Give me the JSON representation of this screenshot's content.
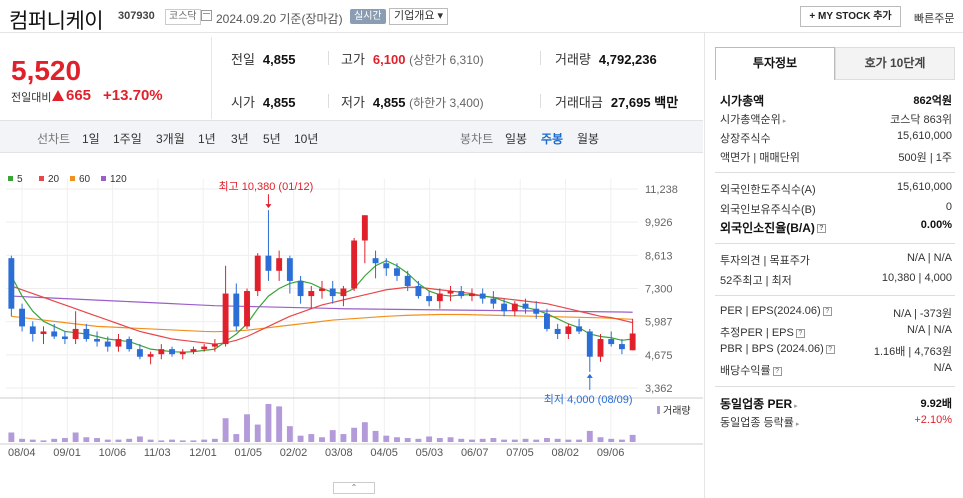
{
  "header": {
    "name": "컴퍼니케이",
    "code": "307930",
    "market": "코스닥",
    "base_time": "2024.09.20 기준(장마감)",
    "realtime": "실시간",
    "corp_info": "기업개요 ▾",
    "mystock": "+ MY STOCK 추가",
    "quick_order": "빠른주문"
  },
  "price": {
    "current": "5,520",
    "prev_label": "전일대비",
    "change": "665",
    "change_pct": "+13.70%"
  },
  "stats": {
    "prev_close_label": "전일",
    "prev_close": "4,855",
    "high_label": "고가",
    "high": "6,100",
    "upper_limit": "(상한가 6,310)",
    "volume_label": "거래량",
    "volume": "4,792,236",
    "open_label": "시가",
    "open": "4,855",
    "low_label": "저가",
    "low": "4,855",
    "lower_limit": "(하한가 3,400)",
    "amount_label": "거래대금",
    "amount": "27,695",
    "amount_unit": "백만"
  },
  "ranges": {
    "line_label": "선차트",
    "line": [
      "1일",
      "1주일",
      "3개월",
      "1년",
      "3년",
      "5년",
      "10년"
    ],
    "candle_label": "봉차트",
    "candle": [
      "일봉",
      "주봉",
      "월봉"
    ],
    "candle_selected": "주봉"
  },
  "chart_data": {
    "type": "candlestick",
    "legend": [
      "5",
      "20",
      "60",
      "120"
    ],
    "legend_colors": [
      "#3aa43a",
      "#e8474a",
      "#f0911f",
      "#9b5fc9"
    ],
    "y_ticks": [
      "11,238",
      "9,926",
      "8,613",
      "7,300",
      "5,987",
      "4,675",
      "3,362"
    ],
    "ylim": [
      3362,
      11238
    ],
    "x_labels": [
      "08/04",
      "09/01",
      "10/06",
      "11/03",
      "12/01",
      "01/05",
      "02/02",
      "03/08",
      "04/05",
      "05/03",
      "06/07",
      "07/05",
      "08/02",
      "09/06"
    ],
    "volume_label": "거래량",
    "annot_high": "최고 10,380 (01/12)",
    "annot_low": "최저 4,000 (08/09)",
    "candles": [
      [
        8500,
        8600,
        6200,
        6500
      ],
      [
        6500,
        6700,
        5600,
        5800
      ],
      [
        5800,
        6000,
        5200,
        5500
      ],
      [
        5500,
        5800,
        5100,
        5600
      ],
      [
        5600,
        5900,
        5300,
        5400
      ],
      [
        5400,
        5600,
        5100,
        5300
      ],
      [
        5300,
        6400,
        5100,
        5700
      ],
      [
        5700,
        5900,
        5200,
        5300
      ],
      [
        5300,
        5600,
        5000,
        5200
      ],
      [
        5200,
        5400,
        4800,
        5000
      ],
      [
        5000,
        5500,
        4800,
        5300
      ],
      [
        5300,
        5400,
        4800,
        4900
      ],
      [
        4900,
        5100,
        4500,
        4600
      ],
      [
        4600,
        4800,
        4300,
        4700
      ],
      [
        4700,
        5100,
        4500,
        4900
      ],
      [
        4900,
        5000,
        4600,
        4700
      ],
      [
        4700,
        4900,
        4500,
        4800
      ],
      [
        4800,
        5000,
        4700,
        4900
      ],
      [
        4900,
        5100,
        4800,
        5000
      ],
      [
        5000,
        5300,
        4800,
        5100
      ],
      [
        5100,
        8200,
        5000,
        7100
      ],
      [
        7100,
        7500,
        5600,
        5800
      ],
      [
        5800,
        7300,
        5700,
        7200
      ],
      [
        7200,
        8700,
        7000,
        8600
      ],
      [
        8600,
        10400,
        7600,
        8000
      ],
      [
        8000,
        8800,
        7600,
        8500
      ],
      [
        8500,
        8600,
        7100,
        7600
      ],
      [
        7600,
        7800,
        6700,
        7000
      ],
      [
        7000,
        7400,
        6500,
        7200
      ],
      [
        7200,
        7600,
        6900,
        7300
      ],
      [
        7300,
        7600,
        6700,
        7000
      ],
      [
        7000,
        7400,
        6600,
        7300
      ],
      [
        7300,
        9300,
        7200,
        9200
      ],
      [
        9200,
        10200,
        8300,
        10200
      ],
      [
        8500,
        8800,
        7700,
        8300
      ],
      [
        8300,
        8500,
        7800,
        8100
      ],
      [
        8100,
        8300,
        7600,
        7800
      ],
      [
        7800,
        8000,
        7200,
        7400
      ],
      [
        7400,
        7600,
        6900,
        7000
      ],
      [
        7000,
        7200,
        6600,
        6800
      ],
      [
        6800,
        7300,
        6500,
        7100
      ],
      [
        7100,
        7400,
        6800,
        7200
      ],
      [
        7200,
        7400,
        6900,
        7000
      ],
      [
        7000,
        7300,
        6800,
        7100
      ],
      [
        7100,
        7300,
        6700,
        6900
      ],
      [
        6900,
        7200,
        6500,
        6700
      ],
      [
        6700,
        6900,
        6200,
        6400
      ],
      [
        6400,
        6800,
        6200,
        6700
      ],
      [
        6700,
        6900,
        6300,
        6500
      ],
      [
        6500,
        6800,
        6100,
        6300
      ],
      [
        6300,
        6500,
        5600,
        5700
      ],
      [
        5700,
        5900,
        5300,
        5500
      ],
      [
        5500,
        5900,
        5300,
        5800
      ],
      [
        5800,
        6100,
        5500,
        5600
      ],
      [
        5600,
        5700,
        4000,
        4600
      ],
      [
        4600,
        5500,
        4400,
        5300
      ],
      [
        5300,
        5600,
        5000,
        5100
      ],
      [
        5100,
        5300,
        4700,
        4900
      ],
      [
        4855,
        6100,
        4855,
        5520
      ]
    ],
    "ma": {
      "5": [
        7800,
        7000,
        6400,
        6000,
        5800,
        5600,
        5550,
        5500,
        5400,
        5300,
        5250,
        5200,
        5050,
        4900,
        4850,
        4800,
        4780,
        4800,
        4850,
        4900,
        5200,
        5500,
        5900,
        6500,
        7000,
        7300,
        7500,
        7600,
        7500,
        7300,
        7150,
        7100,
        7300,
        7800,
        8200,
        8400,
        8200,
        7900,
        7500,
        7200,
        7050,
        7000,
        7050,
        7050,
        7000,
        6950,
        6800,
        6650,
        6550,
        6450,
        6300,
        6100,
        5900,
        5750,
        5500,
        5400,
        5350,
        5250,
        5300
      ],
      "20": [
        7400,
        7250,
        7100,
        6950,
        6800,
        6650,
        6500,
        6350,
        6200,
        6050,
        5900,
        5750,
        5600,
        5500,
        5400,
        5300,
        5250,
        5200,
        5150,
        5100,
        5150,
        5250,
        5400,
        5600,
        5800,
        6000,
        6200,
        6350,
        6500,
        6650,
        6750,
        6850,
        6950,
        7050,
        7150,
        7250,
        7300,
        7350,
        7350,
        7300,
        7250,
        7200,
        7150,
        7100,
        7000,
        6950,
        6900,
        6850,
        6800,
        6750,
        6700,
        6600,
        6500,
        6400,
        6300,
        6200,
        6150,
        6050,
        5950
      ],
      "60": [
        6200,
        6150,
        6100,
        6050,
        6000,
        5950,
        5900,
        5850,
        5800,
        5780,
        5760,
        5740,
        5720,
        5700,
        5680,
        5660,
        5640,
        5620,
        5600,
        5590,
        5600,
        5620,
        5650,
        5700,
        5750,
        5800,
        5850,
        5900,
        5950,
        6000,
        6050,
        6080,
        6110,
        6140,
        6170,
        6200,
        6220,
        6240,
        6250,
        6260,
        6270,
        6270,
        6270,
        6260,
        6250,
        6240,
        6230,
        6220,
        6210,
        6200,
        6190,
        6180,
        6170,
        6160,
        6150,
        6140,
        6120,
        6100,
        6080
      ],
      "120": [
        7000,
        6980,
        6960,
        6940,
        6920,
        6900,
        6880,
        6860,
        6840,
        6820,
        6800,
        6780,
        6760,
        6740,
        6720,
        6700,
        6680,
        6660,
        6640,
        6620,
        6610,
        6600,
        6590,
        6580,
        6570,
        6560,
        6550,
        6540,
        6530,
        6520,
        6510,
        6500,
        6495,
        6490,
        6485,
        6480,
        6475,
        6470,
        6465,
        6460,
        6455,
        6450,
        6445,
        6440,
        6435,
        6430,
        6425,
        6420,
        6415,
        6410,
        6405,
        6400,
        6395,
        6390,
        6385,
        6380,
        6375,
        6370,
        6360
      ]
    },
    "volumes": [
      12,
      4,
      3,
      2,
      4,
      5,
      12,
      6,
      5,
      3,
      3,
      4,
      7,
      3,
      2,
      3,
      2,
      2,
      3,
      4,
      30,
      10,
      35,
      22,
      48,
      45,
      20,
      8,
      10,
      6,
      15,
      10,
      18,
      25,
      14,
      8,
      6,
      5,
      4,
      7,
      5,
      6,
      4,
      3,
      4,
      5,
      3,
      3,
      4,
      3,
      5,
      4,
      3,
      3,
      14,
      6,
      4,
      3,
      9
    ]
  },
  "info": {
    "tab_active": "투자정보",
    "tab_other": "호가 10단계",
    "market_cap_label": "시가총액",
    "market_cap": "862억원",
    "rank_label": "시가총액순위",
    "rank": "코스닥 863위",
    "shares_label": "상장주식수",
    "shares": "15,610,000",
    "par_label": "액면가 | 매매단위",
    "par": "500원 | 1주",
    "foreign_limit_label": "외국인한도주식수(A)",
    "foreign_limit": "15,610,000",
    "foreign_hold_label": "외국인보유주식수(B)",
    "foreign_hold": "0",
    "foreign_ratio_label": "외국인소진율(B/A)",
    "foreign_ratio": "0.00%",
    "opinion_label": "투자의견 | 목표주가",
    "opinion": "N/A | N/A",
    "w52_label": "52주최고 | 최저",
    "w52": "10,380 | 4,000",
    "per_label": "PER | EPS(2024.06)",
    "per": "N/A | -373원",
    "eper_label": "추정PER | EPS",
    "eper": "N/A | N/A",
    "pbr_label": "PBR | BPS (2024.06)",
    "pbr": "1.16배 | 4,763원",
    "div_label": "배당수익률",
    "div": "N/A",
    "ind_per_label": "동일업종 PER",
    "ind_per": "9.92배",
    "ind_rate_label": "동일업종 등락률",
    "ind_rate": "+2.10%"
  }
}
